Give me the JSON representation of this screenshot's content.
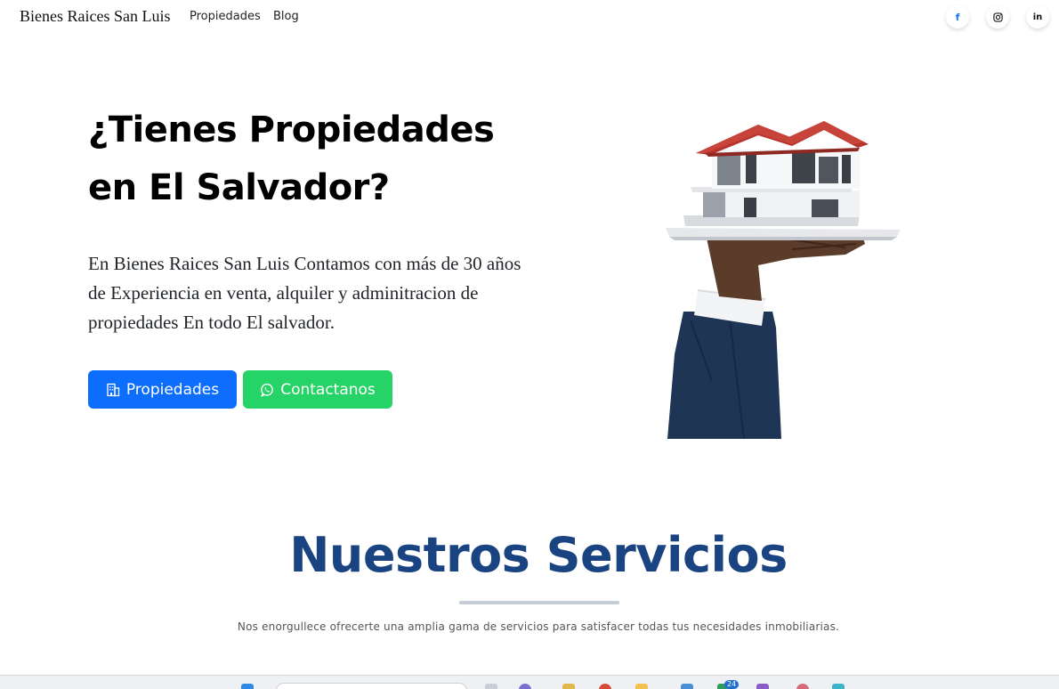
{
  "nav": {
    "brand": "Bienes Raices San Luis",
    "links": [
      "Propiedades",
      "Blog"
    ],
    "social": {
      "facebook_icon": "f",
      "instagram_icon": "instagram-icon",
      "linkedin_icon": "in"
    }
  },
  "hero": {
    "title": "¿Tienes Propiedades en El Salvador?",
    "text": "En Bienes Raices San Luis Contamos con más de 30 años de Experiencia en venta, alquiler y adminitracion de propiedades En todo El salvador.",
    "buttons": {
      "properties": "Propiedades",
      "contact": "Contactanos"
    },
    "image_icon": "house-on-hand-image"
  },
  "services": {
    "title": "Nuestros Servicios",
    "subtitle": "Nos enorgullece ofrecerte una amplia gama de servicios para satisfacer todas tus necesidades inmobiliarias."
  },
  "taskbar": {
    "badge": "24"
  },
  "colors": {
    "primary": "#0d6efd",
    "whatsapp": "#25d366",
    "heading_blue": "#1a4381",
    "facebook": "#1877f2"
  }
}
